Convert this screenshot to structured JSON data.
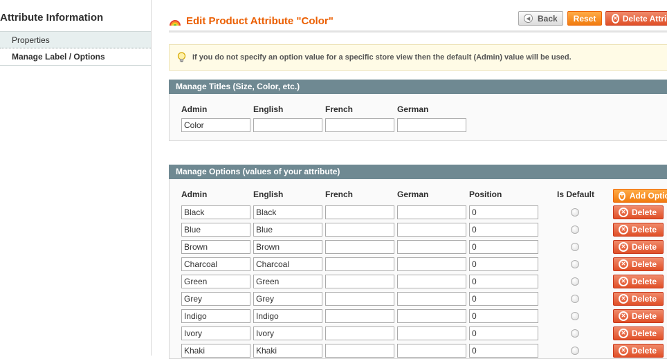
{
  "sidebar": {
    "title": "Attribute Information",
    "items": [
      {
        "label": "Properties"
      },
      {
        "label": "Manage Label / Options"
      }
    ]
  },
  "header": {
    "title": "Edit Product Attribute \"Color\"",
    "icon": "rainbow-icon",
    "buttons": {
      "back": "Back",
      "reset": "Reset",
      "delete": "Delete Attribute"
    }
  },
  "notice": {
    "icon": "lightbulb-icon",
    "text": "If you do not specify an option value for a specific store view then the default (Admin) value will be used."
  },
  "manage_titles": {
    "heading": "Manage Titles (Size, Color, etc.)",
    "columns": [
      "Admin",
      "English",
      "French",
      "German"
    ],
    "values": [
      "Color",
      "",
      "",
      ""
    ]
  },
  "manage_options": {
    "heading": "Manage Options (values of your attribute)",
    "columns": [
      "Admin",
      "English",
      "French",
      "German",
      "Position",
      "Is Default"
    ],
    "add_button": "Add Option",
    "delete_label": "Delete",
    "rows": [
      {
        "admin": "Black",
        "english": "Black",
        "french": "",
        "german": "",
        "position": "0"
      },
      {
        "admin": "Blue",
        "english": "Blue",
        "french": "",
        "german": "",
        "position": "0"
      },
      {
        "admin": "Brown",
        "english": "Brown",
        "french": "",
        "german": "",
        "position": "0"
      },
      {
        "admin": "Charcoal",
        "english": "Charcoal",
        "french": "",
        "german": "",
        "position": "0"
      },
      {
        "admin": "Green",
        "english": "Green",
        "french": "",
        "german": "",
        "position": "0"
      },
      {
        "admin": "Grey",
        "english": "Grey",
        "french": "",
        "german": "",
        "position": "0"
      },
      {
        "admin": "Indigo",
        "english": "Indigo",
        "french": "",
        "german": "",
        "position": "0"
      },
      {
        "admin": "Ivory",
        "english": "Ivory",
        "french": "",
        "german": "",
        "position": "0"
      },
      {
        "admin": "Khaki",
        "english": "Khaki",
        "french": "",
        "german": "",
        "position": "0"
      }
    ]
  },
  "colors": {
    "accent_orange": "#eb5e00",
    "section_header": "#6f8992",
    "delete_red": "#e04f27"
  }
}
